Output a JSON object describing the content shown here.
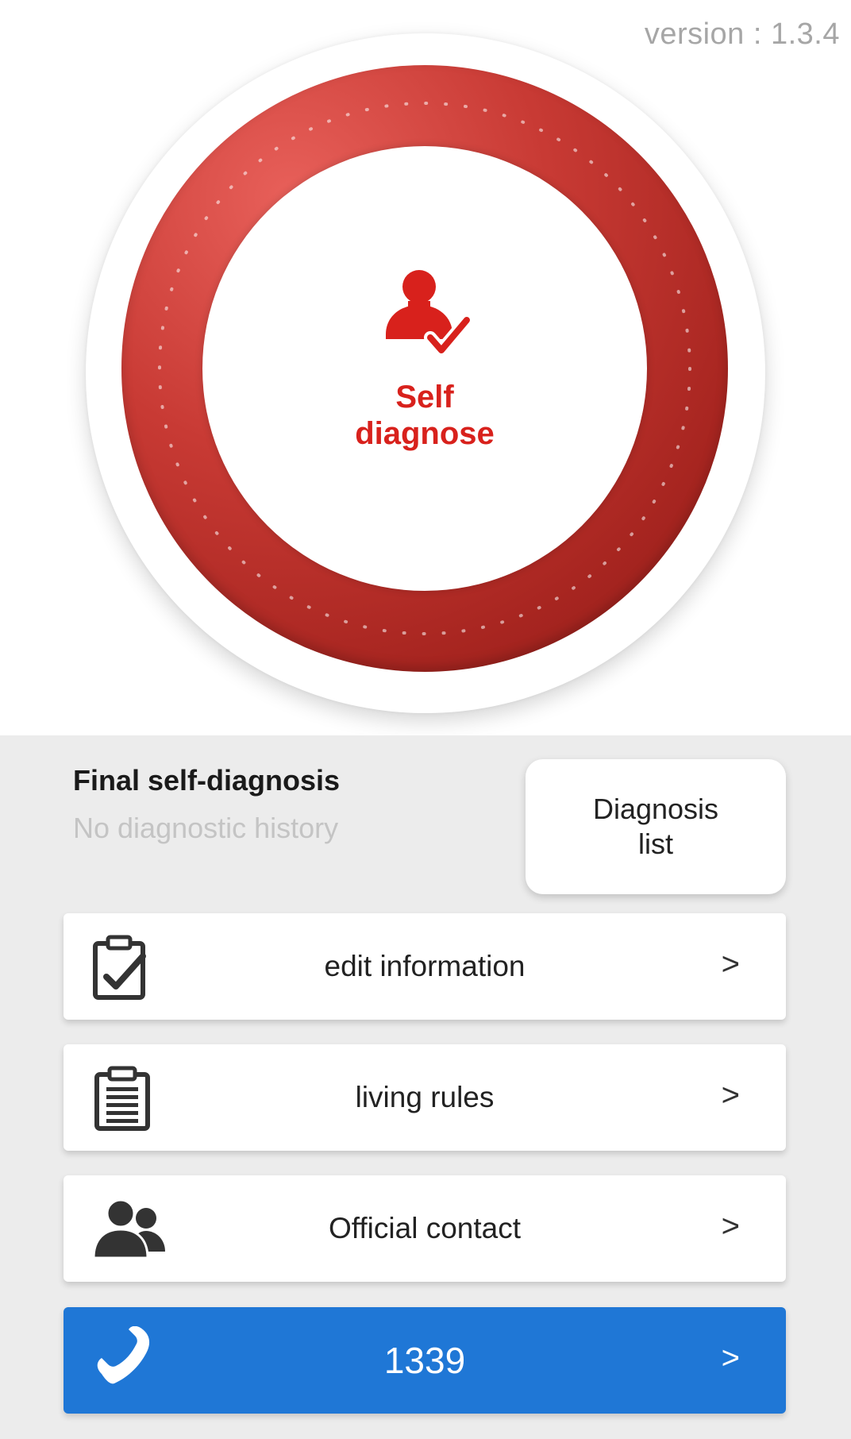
{
  "header": {
    "version": "version : 1.3.4"
  },
  "hero": {
    "label": "Self diagnose",
    "icon": "person-check-icon",
    "ring_color": "#c3302b",
    "text_color": "#d8211c"
  },
  "status": {
    "title": "Final self-diagnosis",
    "subtitle": "No diagnostic history"
  },
  "diagnosis_list_button": {
    "label": "Diagnosis list"
  },
  "menu": [
    {
      "label": "edit information",
      "icon": "clipboard-check-icon"
    },
    {
      "label": "living rules",
      "icon": "clipboard-list-icon"
    },
    {
      "label": "Official contact",
      "icon": "people-icon"
    }
  ],
  "call": {
    "label": "1339",
    "icon": "phone-icon",
    "color": "#1f77d6"
  },
  "chevron": ">"
}
